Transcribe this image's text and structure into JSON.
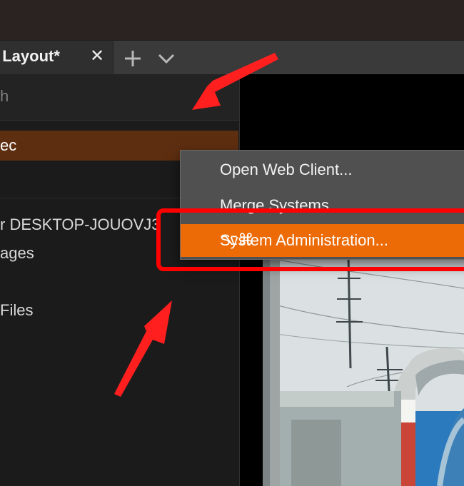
{
  "window": {
    "tab": {
      "title": "w Layout*",
      "close_icon": "close-icon"
    },
    "tab_actions": {
      "add_icon": "plus-icon",
      "menu_icon": "chevron-down-icon"
    }
  },
  "sidebar": {
    "search_text": "h",
    "selected_item": "ec",
    "server_text": "r DESKTOP-JOUOVJ3",
    "images_label": "ages",
    "files_label": "Files"
  },
  "context_menu": {
    "open_web_client": "Open Web Client...",
    "merge_systems": "Merge Systems...",
    "system_administration": "System Administration...",
    "shortcut": "⌥⌘"
  },
  "colors": {
    "accent_orange": "#ec6b07",
    "selection_brown": "#5e2e10",
    "annotation_red": "#ff0000"
  }
}
